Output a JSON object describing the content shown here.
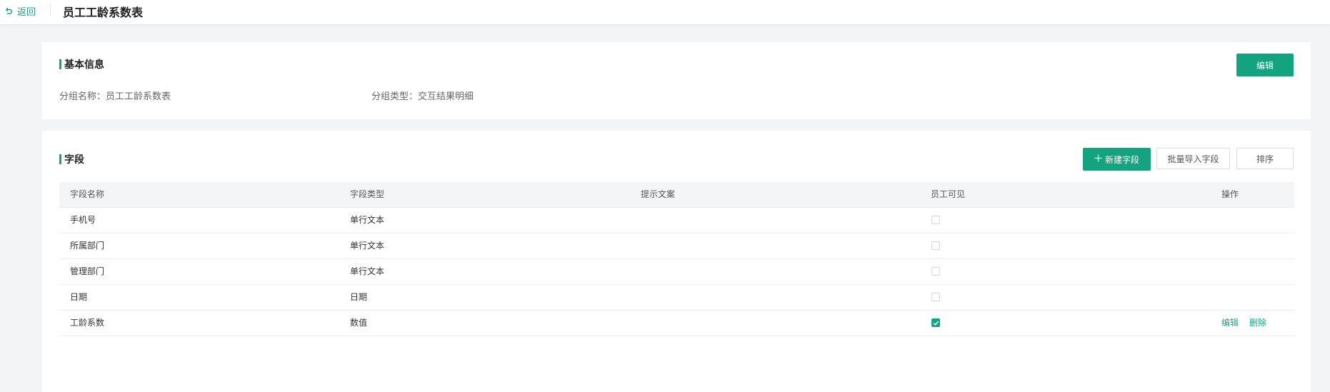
{
  "header": {
    "back_label": "返回",
    "title": "员工工龄系数表"
  },
  "basic": {
    "title": "基本信息",
    "edit_label": "编辑",
    "group_name_key": "分组名称：",
    "group_name_value": "员工工龄系数表",
    "group_type_key": "分组类型：",
    "group_type_value": "交互结果明细"
  },
  "fields": {
    "title": "字段",
    "new_field_label": "新建字段",
    "batch_import_label": "批量导入字段",
    "sort_label": "排序",
    "columns": [
      "字段名称",
      "字段类型",
      "提示文案",
      "员工可见",
      "操作"
    ],
    "rows": [
      {
        "name": "手机号",
        "type": "单行文本",
        "hint": "",
        "visible": false,
        "actions": []
      },
      {
        "name": "所属部门",
        "type": "单行文本",
        "hint": "",
        "visible": false,
        "actions": []
      },
      {
        "name": "管理部门",
        "type": "单行文本",
        "hint": "",
        "visible": false,
        "actions": []
      },
      {
        "name": "日期",
        "type": "日期",
        "hint": "",
        "visible": false,
        "actions": []
      },
      {
        "name": "工龄系数",
        "type": "数值",
        "hint": "",
        "visible": true,
        "actions": [
          "编辑",
          "删除"
        ]
      }
    ]
  },
  "colors": {
    "accent": "#13a37e",
    "background": "#f3f4f5"
  }
}
